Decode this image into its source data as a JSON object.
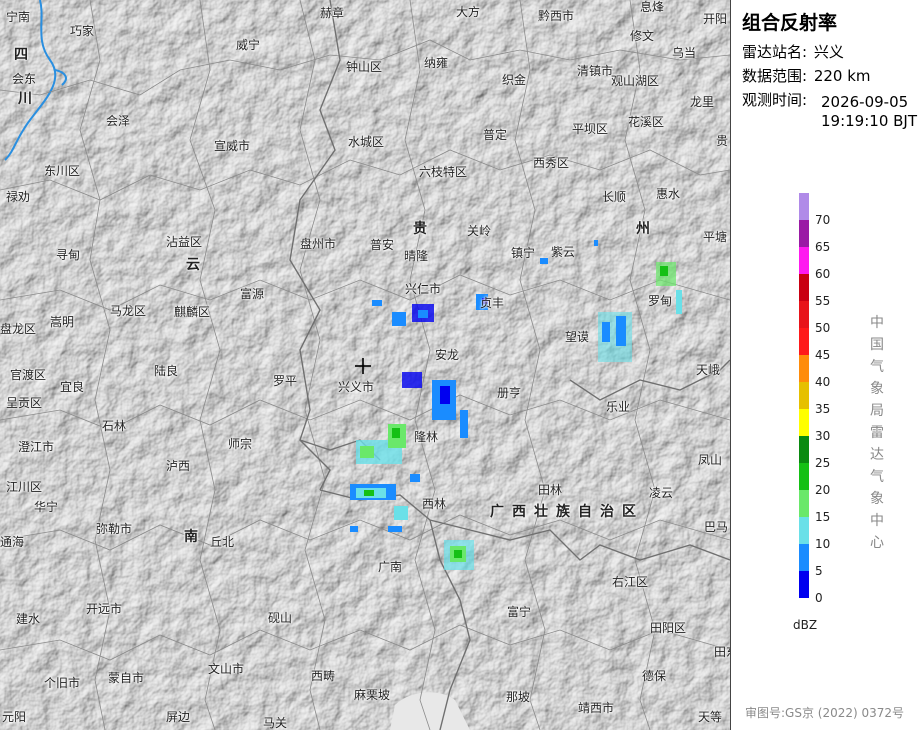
{
  "panel": {
    "title": "组合反射率",
    "station_label": "雷达站名:",
    "station_value": "兴义",
    "range_label": "数据范围:",
    "range_value": "220 km",
    "time_label": "观测时间:",
    "time_date": "2026-09-05",
    "time_clock": "19:19:10 BJT",
    "unit": "dBZ",
    "agency_vertical": "中国气象局雷达气象中心",
    "footer": "审图号:GS京 (2022) 0372号"
  },
  "legend": {
    "ticks": [
      "70",
      "65",
      "60",
      "55",
      "50",
      "45",
      "40",
      "35",
      "30",
      "25",
      "20",
      "15",
      "10",
      "5",
      "0"
    ],
    "colors": [
      "#b08ae8",
      "#9a1aa5",
      "#ff1af0",
      "#c90012",
      "#e8141a",
      "#ff1a1a",
      "#ff8c0a",
      "#e6c000",
      "#ffff00",
      "#0a8a10",
      "#15c015",
      "#6ae86a",
      "#6ae0e8",
      "#1a8cff",
      "#0000f0"
    ]
  },
  "map": {
    "radar_center_icon": "crosshair-icon",
    "places": [
      {
        "name": "宁南"
      },
      {
        "name": "巧家"
      },
      {
        "name": "会东"
      },
      {
        "name": "四"
      },
      {
        "name": "川"
      },
      {
        "name": "会泽"
      },
      {
        "name": "东川区"
      },
      {
        "name": "禄劝"
      },
      {
        "name": "寻甸"
      },
      {
        "name": "马龙区"
      },
      {
        "name": "嵩明"
      },
      {
        "name": "盘龙区"
      },
      {
        "name": "官渡区"
      },
      {
        "name": "呈贡区"
      },
      {
        "name": "宜良"
      },
      {
        "name": "澄江市"
      },
      {
        "name": "江川区"
      },
      {
        "name": "华宁"
      },
      {
        "name": "通海"
      },
      {
        "name": "建水"
      },
      {
        "name": "个旧市"
      },
      {
        "name": "元阳"
      },
      {
        "name": "蒙自市"
      },
      {
        "name": "开远市"
      },
      {
        "name": "弥勒市"
      },
      {
        "name": "屏边"
      },
      {
        "name": "石林"
      },
      {
        "name": "泸西"
      },
      {
        "name": "陆良"
      },
      {
        "name": "师宗"
      },
      {
        "name": "宣威市"
      },
      {
        "name": "沾益区"
      },
      {
        "name": "云"
      },
      {
        "name": "麒麟区"
      },
      {
        "name": "富源"
      },
      {
        "name": "威宁"
      },
      {
        "name": "赫章"
      },
      {
        "name": "钟山区"
      },
      {
        "name": "纳雍"
      },
      {
        "name": "水城区"
      },
      {
        "name": "盘州市"
      },
      {
        "name": "普安"
      },
      {
        "name": "晴隆"
      },
      {
        "name": "兴仁市"
      },
      {
        "name": "罗平"
      },
      {
        "name": "兴义市"
      },
      {
        "name": "安龙"
      },
      {
        "name": "贞丰"
      },
      {
        "name": "册亨"
      },
      {
        "name": "望谟"
      },
      {
        "name": "隆林"
      },
      {
        "name": "西林"
      },
      {
        "name": "田林"
      },
      {
        "name": "乐业"
      },
      {
        "name": "凌云"
      },
      {
        "name": "广南"
      },
      {
        "name": "富宁"
      },
      {
        "name": "丘北"
      },
      {
        "name": "南"
      },
      {
        "name": "砚山"
      },
      {
        "name": "文山市"
      },
      {
        "name": "西畴"
      },
      {
        "name": "麻栗坡"
      },
      {
        "name": "马关"
      },
      {
        "name": "那坡"
      },
      {
        "name": "靖西市"
      },
      {
        "name": "德保"
      },
      {
        "name": "田阳区"
      },
      {
        "name": "右江区"
      },
      {
        "name": "巴马"
      },
      {
        "name": "凤山"
      },
      {
        "name": "天峨"
      },
      {
        "name": "罗甸"
      },
      {
        "name": "平塘"
      },
      {
        "name": "惠水"
      },
      {
        "name": "长顺"
      },
      {
        "name": "紫云"
      },
      {
        "name": "镇宁"
      },
      {
        "name": "关岭"
      },
      {
        "name": "贵"
      },
      {
        "name": "六枝特区"
      },
      {
        "name": "西秀区"
      },
      {
        "name": "普定"
      },
      {
        "name": "平坝区"
      },
      {
        "name": "织金"
      },
      {
        "name": "清镇市"
      },
      {
        "name": "观山湖区"
      },
      {
        "name": "花溪区"
      },
      {
        "name": "龙里"
      },
      {
        "name": "贵"
      },
      {
        "name": "乌当"
      },
      {
        "name": "修文"
      },
      {
        "name": "息烽"
      },
      {
        "name": "开阳"
      },
      {
        "name": "黔西市"
      },
      {
        "name": "大方"
      },
      {
        "name": "州"
      },
      {
        "name": "田东"
      },
      {
        "name": "天等"
      },
      {
        "name": "广西壮族自治区"
      }
    ]
  }
}
